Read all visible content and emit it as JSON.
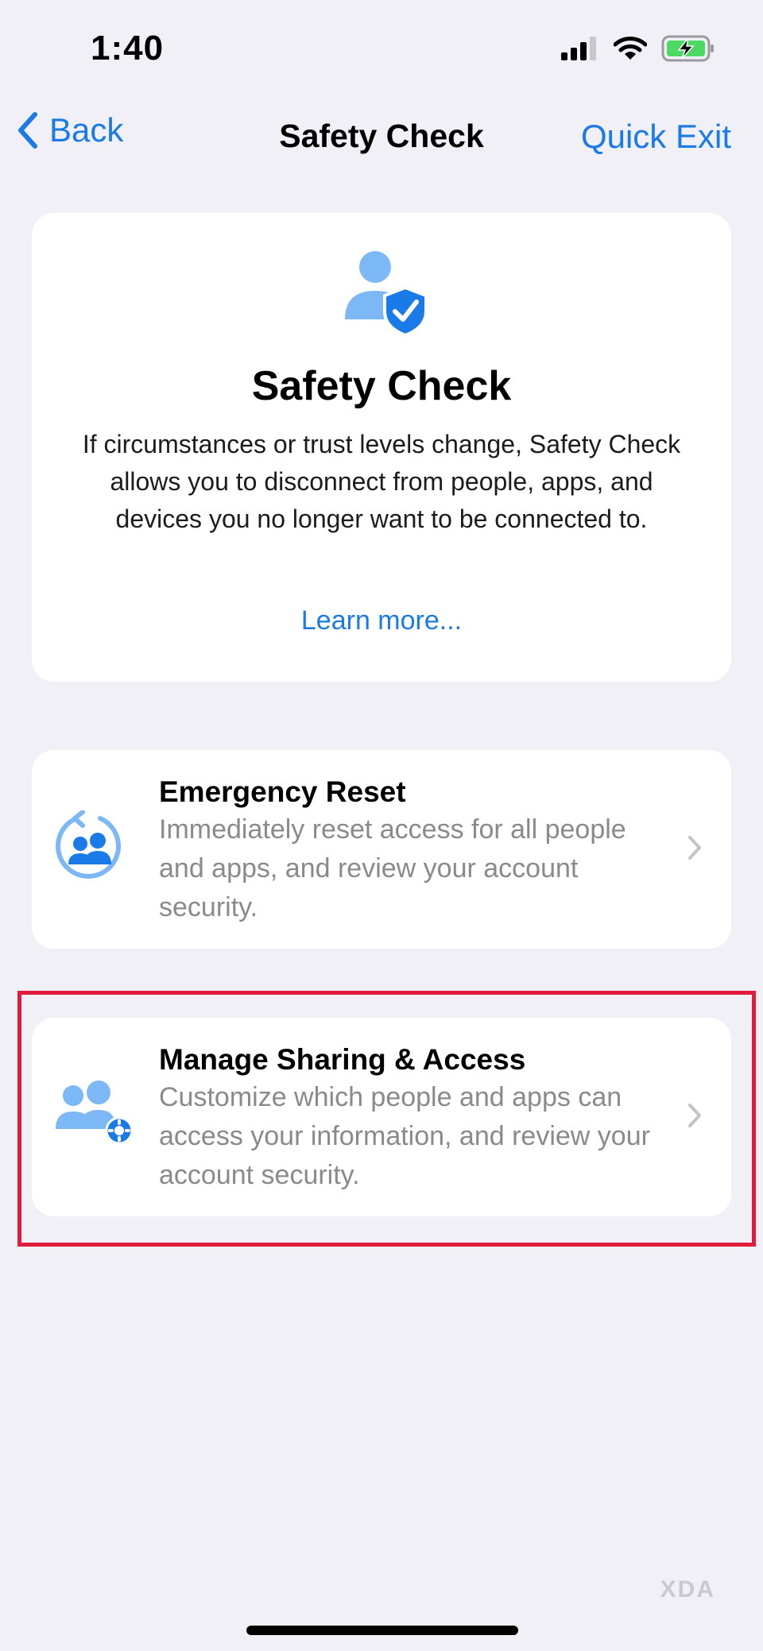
{
  "status_bar": {
    "time": "1:40"
  },
  "nav": {
    "back_label": "Back",
    "title": "Safety Check",
    "quick_exit_label": "Quick Exit"
  },
  "intro": {
    "title": "Safety Check",
    "description": "If circumstances or trust levels change, Safety Check allows you to disconnect from people, apps, and devices you no longer want to be connected to.",
    "learn_more": "Learn more..."
  },
  "options": [
    {
      "title": "Emergency Reset",
      "description": "Immediately reset access for all people and apps, and review your account security.",
      "icon": "emergency-reset-icon"
    },
    {
      "title": "Manage Sharing & Access",
      "description": "Customize which people and apps can access your information, and review your account security.",
      "icon": "people-gear-icon"
    }
  ],
  "watermark": "XDA",
  "colors": {
    "accent": "#1a7ae8",
    "highlight": "#e01b3c",
    "background": "#f1f0f6",
    "battery_green": "#4cd964"
  }
}
